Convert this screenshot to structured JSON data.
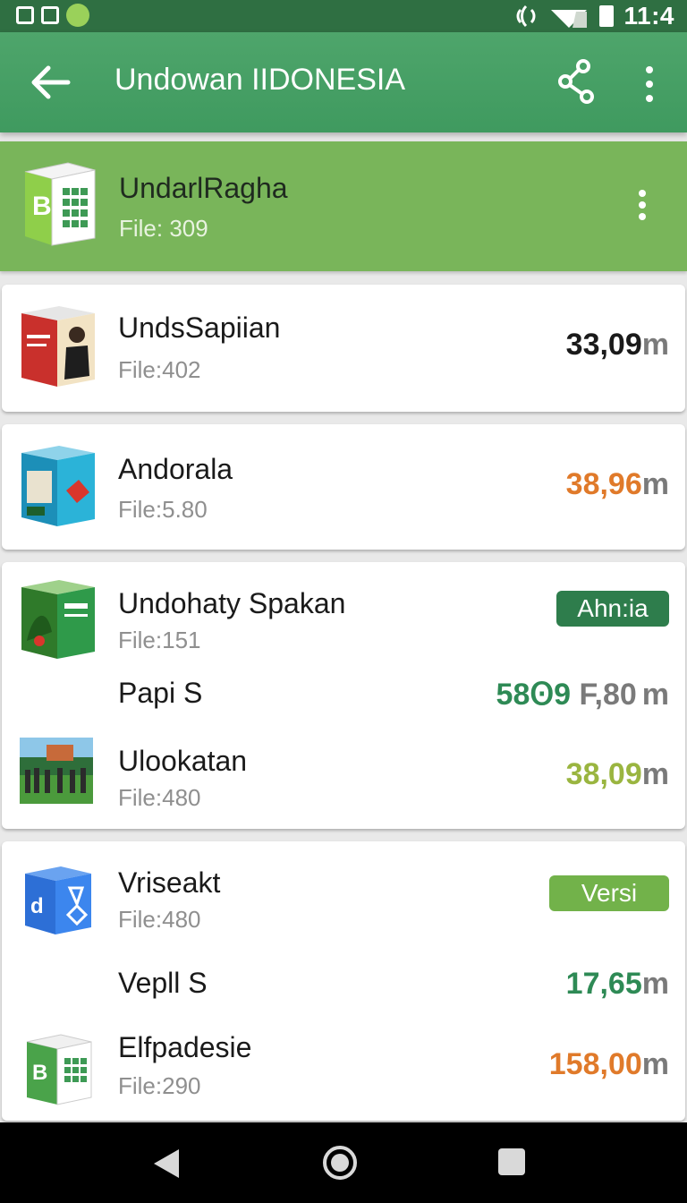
{
  "status_bar": {
    "time": "11:4"
  },
  "app_bar": {
    "title": "Undowan IIDONESIA"
  },
  "featured": {
    "name": "UndarlRagha",
    "files": "File: 309"
  },
  "cards": [
    {
      "name": "UndsSapiian",
      "files": "File:402",
      "size_num": "33,09",
      "size_unit": "m",
      "size_color": "#1a1a1a"
    },
    {
      "name": "Andorala",
      "files": "File:5.80",
      "size_num": "38,96",
      "size_unit": "m",
      "size_color": "#e07a2a"
    }
  ],
  "group1": {
    "rows": [
      {
        "name": "Undohaty Spakan",
        "files": "File:151",
        "badge": "Ahn:ia",
        "badge_color": "#2e7d4c"
      },
      {
        "name": "Papi S",
        "size_num_a": "58Ꙩ9",
        "size_num_b": " F,80",
        "size_unit": "m"
      },
      {
        "name": "Ulookatan",
        "files": "File:480",
        "size_num": "38,09",
        "size_unit": "m",
        "size_color": "#9ab540"
      }
    ]
  },
  "group2": {
    "rows": [
      {
        "name": "Vriseakt",
        "files": "File:480",
        "badge": "Versi",
        "badge_color": "#72b24a"
      },
      {
        "name": "Vepll S",
        "size_num": "17,65",
        "size_unit": "m",
        "size_color": "#2e8a55"
      },
      {
        "name": "Elfpadesie",
        "files": "File:290",
        "size_num": "158,00",
        "size_unit": "m",
        "size_color": "#e07a2a"
      }
    ]
  },
  "colors": {
    "appbar": "#46a063",
    "featured": "#79b55a",
    "accent_green": "#2e7d4c",
    "accent_orange": "#e07a2a"
  },
  "icons": [
    "back-arrow-icon",
    "share-icon",
    "more-vert-icon",
    "spreadsheet-box-icon",
    "home-icon",
    "recent-apps-icon"
  ]
}
